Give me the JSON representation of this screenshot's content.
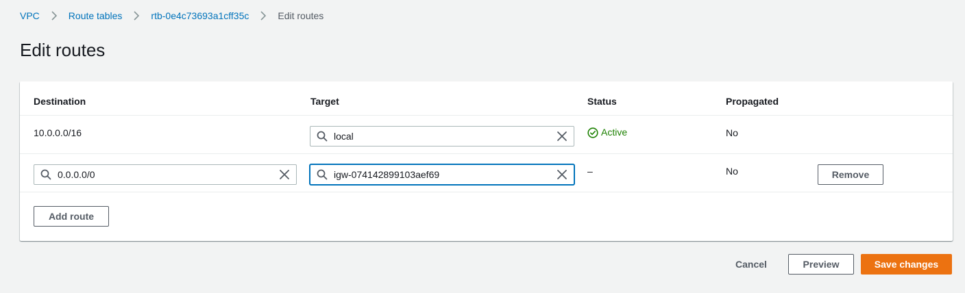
{
  "breadcrumb": {
    "items": [
      {
        "label": "VPC"
      },
      {
        "label": "Route tables"
      },
      {
        "label": "rtb-0e4c73693a1cff35c"
      }
    ],
    "current": "Edit routes"
  },
  "page": {
    "title": "Edit routes"
  },
  "table": {
    "columns": [
      "Destination",
      "Target",
      "Status",
      "Propagated"
    ],
    "rows": [
      {
        "destination": "10.0.0.0/16",
        "target": "local",
        "status": "Active",
        "propagated": "No"
      },
      {
        "destination": "0.0.0.0/0",
        "target": "igw-074142899103aef69",
        "status": "–",
        "propagated": "No",
        "remove_label": "Remove"
      }
    ],
    "add_route_label": "Add route"
  },
  "footer": {
    "cancel_label": "Cancel",
    "preview_label": "Preview",
    "save_label": "Save changes"
  },
  "colors": {
    "link": "#0073bb",
    "primary": "#ec7211",
    "success": "#1d8102",
    "background": "#f2f3f3"
  }
}
